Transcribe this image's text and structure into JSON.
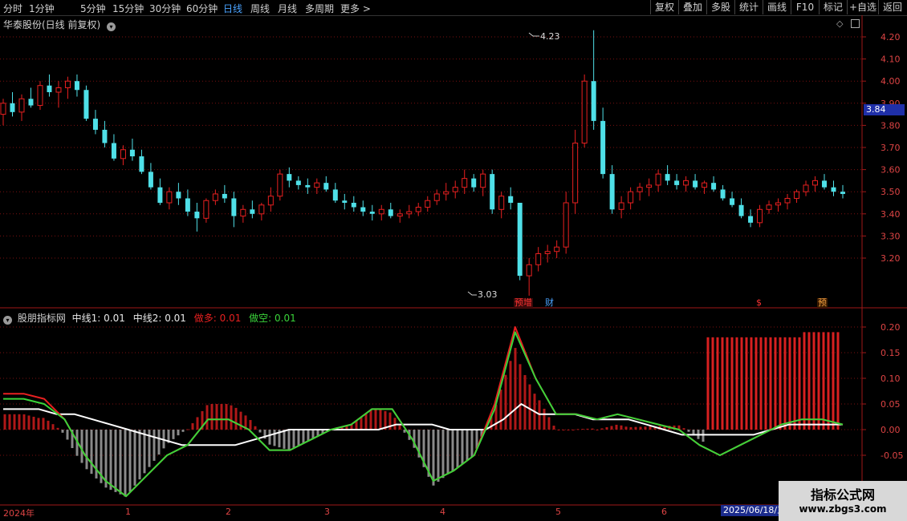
{
  "toolbar": {
    "periods": [
      "分时",
      "1分钟",
      "5分钟",
      "15分钟",
      "30分钟",
      "60分钟",
      "日线",
      "周线",
      "月线",
      "多周期",
      "更多"
    ],
    "active_period": "日线",
    "tools": [
      "复权",
      "叠加",
      "多股",
      "统计",
      "画线",
      "F10",
      "标记",
      "+自选",
      "返回"
    ]
  },
  "chart_title": "华泰股份(日线 前复权)",
  "price_panel": {
    "y_ticks": [
      "4.20",
      "4.10",
      "4.00",
      "3.90",
      "3.80",
      "3.70",
      "3.60",
      "3.50",
      "3.40",
      "3.30",
      "3.20"
    ],
    "current_price": "3.84",
    "high_label": "4.23",
    "low_label": "3.03",
    "markers": [
      "预增",
      "财",
      "$",
      "预"
    ]
  },
  "indicator": {
    "name": "股朋指标网",
    "mid1": "中线1: 0.01",
    "mid2": "中线2: 0.01",
    "long": "做多: 0.01",
    "short": "做空: 0.01",
    "y_ticks": [
      "0.20",
      "0.15",
      "0.10",
      "0.05",
      "0.00",
      "-0.05"
    ]
  },
  "x_axis": {
    "labels": [
      "2024年",
      "1",
      "2",
      "3",
      "4",
      "5",
      "6"
    ],
    "current_date": "2025/06/18/三"
  },
  "watermark": {
    "line1": "指标公式网",
    "line2": "www.zbgs3.com"
  },
  "colors": {
    "up": "#e82020",
    "down": "#4fe0e8",
    "grid": "#7a1010",
    "active": "#4aa3ff",
    "mid1_line": "#ffffff",
    "long_line": "#e82020",
    "short_line": "#3ad43a"
  },
  "chart_data": [
    {
      "type": "candlestick",
      "title": "华泰股份(日线 前复权)",
      "ylim": [
        3.03,
        4.23
      ],
      "series": [
        {
          "values": [
            [
              3.85,
              3.92,
              3.8,
              3.9
            ],
            [
              3.9,
              3.95,
              3.84,
              3.86
            ],
            [
              3.86,
              3.94,
              3.82,
              3.92
            ],
            [
              3.92,
              3.97,
              3.88,
              3.89
            ],
            [
              3.89,
              4.0,
              3.87,
              3.98
            ],
            [
              3.98,
              4.03,
              3.93,
              3.95
            ],
            [
              3.95,
              4.0,
              3.88,
              3.97
            ],
            [
              3.97,
              4.02,
              3.92,
              4.0
            ],
            [
              4.0,
              4.03,
              3.93,
              3.96
            ],
            [
              3.96,
              3.98,
              3.82,
              3.83
            ],
            [
              3.83,
              3.87,
              3.76,
              3.78
            ],
            [
              3.78,
              3.82,
              3.7,
              3.72
            ],
            [
              3.72,
              3.76,
              3.64,
              3.65
            ],
            [
              3.65,
              3.71,
              3.62,
              3.69
            ],
            [
              3.69,
              3.74,
              3.64,
              3.66
            ],
            [
              3.66,
              3.69,
              3.58,
              3.59
            ],
            [
              3.59,
              3.63,
              3.51,
              3.52
            ],
            [
              3.52,
              3.56,
              3.44,
              3.45
            ],
            [
              3.45,
              3.52,
              3.42,
              3.5
            ],
            [
              3.5,
              3.54,
              3.44,
              3.47
            ],
            [
              3.47,
              3.51,
              3.39,
              3.41
            ],
            [
              3.41,
              3.45,
              3.32,
              3.38
            ],
            [
              3.38,
              3.47,
              3.36,
              3.46
            ],
            [
              3.46,
              3.51,
              3.44,
              3.49
            ],
            [
              3.49,
              3.53,
              3.45,
              3.47
            ],
            [
              3.47,
              3.5,
              3.34,
              3.39
            ],
            [
              3.39,
              3.44,
              3.36,
              3.42
            ],
            [
              3.42,
              3.46,
              3.38,
              3.4
            ],
            [
              3.4,
              3.45,
              3.37,
              3.44
            ],
            [
              3.44,
              3.52,
              3.41,
              3.48
            ],
            [
              3.48,
              3.6,
              3.46,
              3.58
            ],
            [
              3.58,
              3.61,
              3.52,
              3.55
            ],
            [
              3.55,
              3.57,
              3.51,
              3.53
            ],
            [
              3.53,
              3.56,
              3.49,
              3.52
            ],
            [
              3.52,
              3.56,
              3.49,
              3.54
            ],
            [
              3.54,
              3.57,
              3.5,
              3.51
            ],
            [
              3.51,
              3.54,
              3.45,
              3.46
            ],
            [
              3.46,
              3.49,
              3.42,
              3.45
            ],
            [
              3.45,
              3.48,
              3.41,
              3.43
            ],
            [
              3.43,
              3.46,
              3.39,
              3.41
            ],
            [
              3.41,
              3.44,
              3.37,
              3.4
            ],
            [
              3.4,
              3.44,
              3.37,
              3.42
            ],
            [
              3.42,
              3.45,
              3.38,
              3.39
            ],
            [
              3.39,
              3.42,
              3.36,
              3.4
            ],
            [
              3.4,
              3.44,
              3.38,
              3.41
            ],
            [
              3.41,
              3.45,
              3.39,
              3.43
            ],
            [
              3.43,
              3.48,
              3.41,
              3.46
            ],
            [
              3.46,
              3.51,
              3.44,
              3.49
            ],
            [
              3.49,
              3.54,
              3.46,
              3.5
            ],
            [
              3.5,
              3.55,
              3.47,
              3.52
            ],
            [
              3.52,
              3.6,
              3.49,
              3.56
            ],
            [
              3.56,
              3.58,
              3.5,
              3.52
            ],
            [
              3.52,
              3.6,
              3.48,
              3.58
            ],
            [
              3.58,
              3.6,
              3.4,
              3.42
            ],
            [
              3.42,
              3.5,
              3.38,
              3.48
            ],
            [
              3.48,
              3.52,
              3.42,
              3.45
            ],
            [
              3.45,
              3.24,
              3.1,
              3.12
            ],
            [
              3.12,
              3.2,
              3.03,
              3.17
            ],
            [
              3.17,
              3.25,
              3.14,
              3.22
            ],
            [
              3.22,
              3.26,
              3.18,
              3.23
            ],
            [
              3.23,
              3.28,
              3.2,
              3.25
            ],
            [
              3.25,
              3.5,
              3.22,
              3.45
            ],
            [
              3.45,
              3.78,
              3.4,
              3.72
            ],
            [
              3.72,
              4.03,
              3.7,
              4.0
            ],
            [
              4.0,
              4.23,
              3.78,
              3.82
            ],
            [
              3.82,
              3.88,
              3.56,
              3.58
            ],
            [
              3.58,
              3.62,
              3.4,
              3.42
            ],
            [
              3.42,
              3.48,
              3.38,
              3.45
            ],
            [
              3.45,
              3.52,
              3.42,
              3.5
            ],
            [
              3.5,
              3.54,
              3.46,
              3.52
            ],
            [
              3.52,
              3.56,
              3.48,
              3.53
            ],
            [
              3.53,
              3.6,
              3.5,
              3.58
            ],
            [
              3.58,
              3.62,
              3.53,
              3.55
            ],
            [
              3.55,
              3.58,
              3.51,
              3.53
            ],
            [
              3.53,
              3.57,
              3.5,
              3.55
            ],
            [
              3.55,
              3.58,
              3.51,
              3.52
            ],
            [
              3.52,
              3.55,
              3.49,
              3.54
            ],
            [
              3.54,
              3.57,
              3.5,
              3.51
            ],
            [
              3.51,
              3.53,
              3.46,
              3.47
            ],
            [
              3.47,
              3.5,
              3.43,
              3.44
            ],
            [
              3.44,
              3.47,
              3.38,
              3.39
            ],
            [
              3.39,
              3.42,
              3.34,
              3.36
            ],
            [
              3.36,
              3.44,
              3.34,
              3.42
            ],
            [
              3.42,
              3.46,
              3.4,
              3.44
            ],
            [
              3.44,
              3.47,
              3.41,
              3.45
            ],
            [
              3.45,
              3.49,
              3.42,
              3.47
            ],
            [
              3.47,
              3.51,
              3.45,
              3.5
            ],
            [
              3.5,
              3.55,
              3.48,
              3.53
            ],
            [
              3.53,
              3.57,
              3.5,
              3.55
            ],
            [
              3.55,
              3.58,
              3.51,
              3.52
            ],
            [
              3.52,
              3.55,
              3.48,
              3.5
            ],
            [
              3.5,
              3.53,
              3.47,
              3.49
            ]
          ]
        }
      ]
    },
    {
      "type": "line",
      "title": "股朋指标网",
      "ylim": [
        -0.07,
        0.21
      ],
      "series": [
        {
          "name": "中线1",
          "values": [
            0.04,
            0.04,
            0.04,
            0.03,
            0.03,
            0.02,
            0.01,
            0.0,
            -0.01,
            -0.02,
            -0.03,
            -0.03,
            -0.03,
            -0.03,
            -0.02,
            -0.01,
            0.0,
            0.0,
            0.0,
            0.0,
            0.0,
            0.0,
            0.01,
            0.01,
            0.01,
            0.0,
            0.0,
            0.0,
            0.02,
            0.05,
            0.03,
            0.03,
            0.03,
            0.02,
            0.02,
            0.02,
            0.01,
            0.0,
            -0.01,
            -0.01,
            -0.01,
            -0.01,
            -0.01,
            0.0,
            0.01,
            0.01,
            0.01,
            0.01
          ]
        },
        {
          "name": "做多",
          "values": [
            0.07,
            0.07,
            0.06,
            0.02,
            -0.05,
            -0.1,
            -0.13,
            -0.09,
            -0.05,
            -0.03,
            0.02,
            0.02,
            0.0,
            -0.04,
            -0.04,
            -0.02,
            0.0,
            0.01,
            0.04,
            0.04,
            -0.02,
            -0.1,
            -0.08,
            -0.05,
            0.05,
            0.2,
            0.1,
            0.03,
            0.03,
            0.02,
            0.03,
            0.02,
            0.01,
            0.0,
            -0.03,
            -0.05,
            -0.03,
            -0.01,
            0.01,
            0.02,
            0.02,
            0.01
          ]
        },
        {
          "name": "做空",
          "values": [
            0.06,
            0.06,
            0.05,
            0.02,
            -0.05,
            -0.1,
            -0.13,
            -0.09,
            -0.05,
            -0.03,
            0.02,
            0.02,
            0.0,
            -0.04,
            -0.04,
            -0.02,
            0.0,
            0.01,
            0.04,
            0.04,
            -0.02,
            -0.1,
            -0.08,
            -0.05,
            0.04,
            0.19,
            0.1,
            0.03,
            0.03,
            0.02,
            0.03,
            0.02,
            0.01,
            0.0,
            -0.03,
            -0.05,
            -0.03,
            -0.01,
            0.01,
            0.02,
            0.02,
            0.01
          ]
        }
      ]
    }
  ]
}
